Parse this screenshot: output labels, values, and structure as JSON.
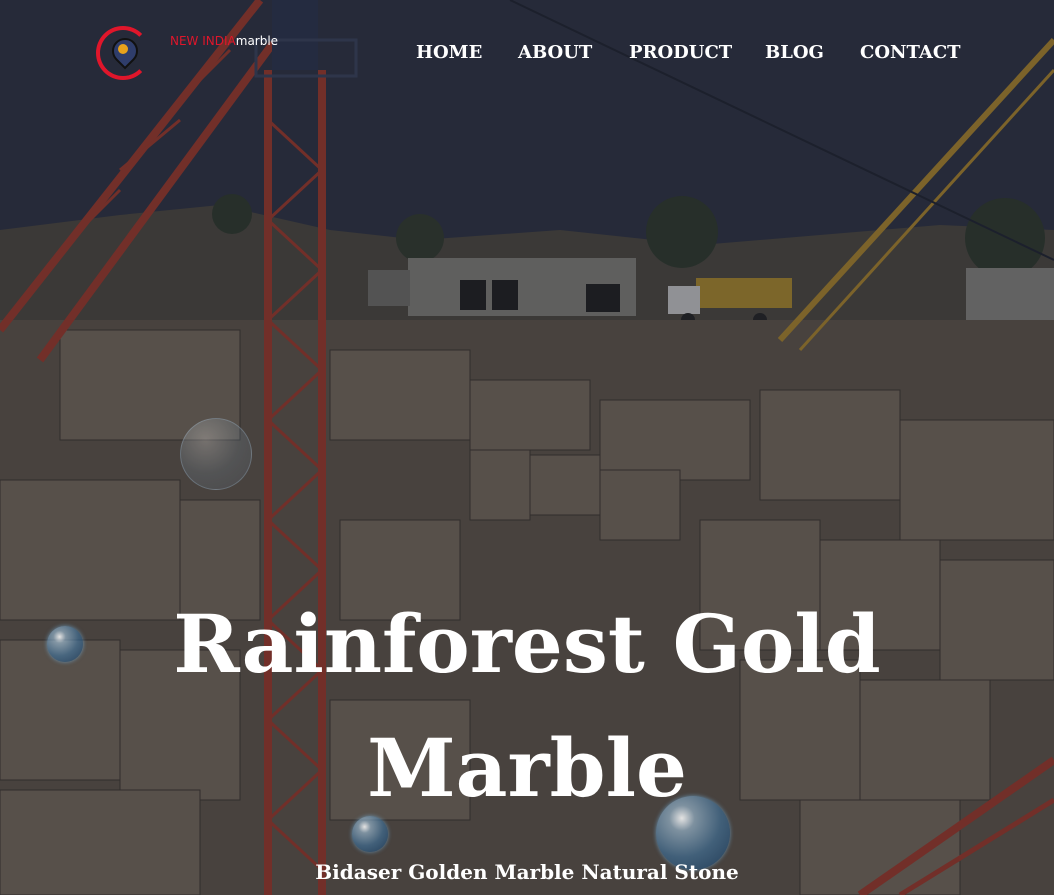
{
  "brand": {
    "name_prefix": "NEW INDIA",
    "name_suffix": "marble",
    "accent_color": "#e0162b"
  },
  "nav": {
    "items": [
      {
        "label": "HOME"
      },
      {
        "label": "ABOUT"
      },
      {
        "label": "PRODUCT"
      },
      {
        "label": "BLOG"
      },
      {
        "label": "CONTACT"
      }
    ]
  },
  "hero": {
    "title_line1": "Rainforest Gold",
    "title_line2": "Marble",
    "subtitle": "Bidaser Golden Marble Natural Stone",
    "background": "marble quarry with red cranes"
  }
}
